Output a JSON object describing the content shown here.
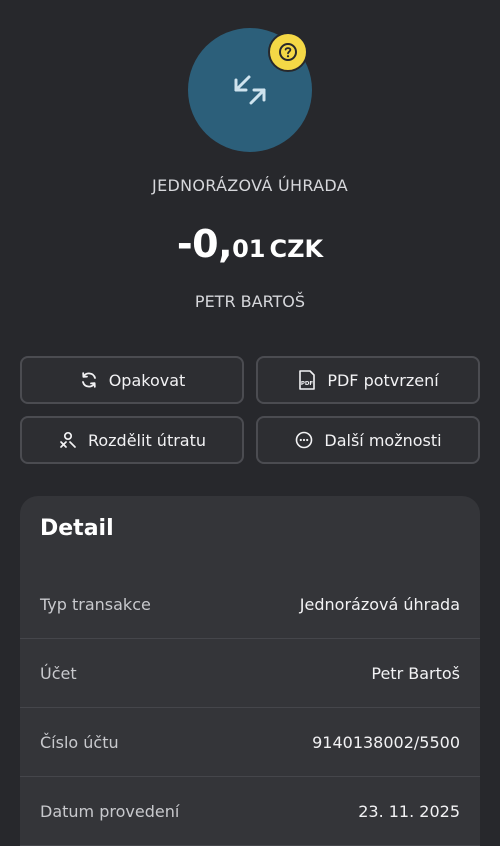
{
  "header": {
    "transaction_type": "JEDNORÁZOVÁ ÚHRADA",
    "amount_whole": "-0,",
    "amount_decimal": "01",
    "currency": "CZK",
    "counterparty": "PETR BARTOŠ",
    "avatar_icon": "transfer-arrows-icon",
    "badge_icon": "question-icon",
    "avatar_color": "#2c5f7a",
    "badge_color": "#f4d846"
  },
  "actions": {
    "repeat": "Opakovat",
    "pdf": "PDF potvrzení",
    "split": "Rozdělit útratu",
    "more": "Další možnosti"
  },
  "detail": {
    "title": "Detail",
    "rows": [
      {
        "label": "Typ transakce",
        "value": "Jednorázová úhrada"
      },
      {
        "label": "Účet",
        "value": "Petr Bartoš"
      },
      {
        "label": "Číslo účtu",
        "value": "9140138002/5500"
      },
      {
        "label": "Datum provedení",
        "value": "23. 11. 2025"
      }
    ]
  }
}
